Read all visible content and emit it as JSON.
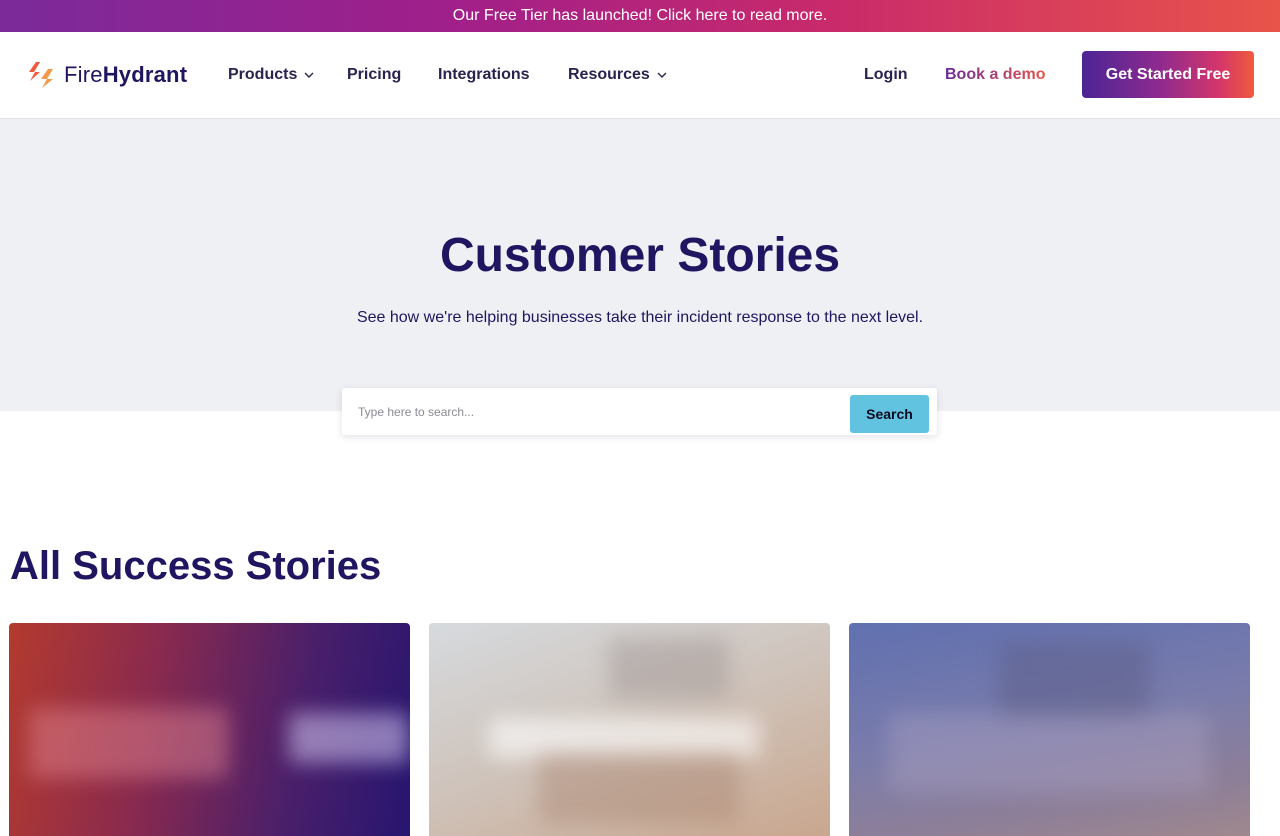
{
  "banner": {
    "text": "Our Free Tier has launched! Click here to read more."
  },
  "logo": {
    "text_light": "Fire",
    "text_bold": "Hydrant",
    "icon": "firehydrant-logo-icon"
  },
  "nav": {
    "items": [
      {
        "label": "Products",
        "has_dropdown": true
      },
      {
        "label": "Pricing",
        "has_dropdown": false
      },
      {
        "label": "Integrations",
        "has_dropdown": false
      },
      {
        "label": "Resources",
        "has_dropdown": true
      }
    ],
    "login": "Login",
    "book_demo": "Book a demo",
    "cta": "Get Started Free"
  },
  "hero": {
    "title": "Customer Stories",
    "subtitle": "See how we're helping businesses take their incident response to the next level."
  },
  "search": {
    "placeholder": "Type here to search...",
    "value": "",
    "button": "Search"
  },
  "section": {
    "title": "All Success Stories"
  },
  "colors": {
    "brand_navy": "#1f1560",
    "hero_bg": "#eff0f4",
    "search_button": "#62c3e0",
    "banner_gradient": [
      "#7b2a9a",
      "#c92a6a",
      "#e8544a"
    ],
    "cta_gradient": [
      "#4b2595",
      "#d4366a",
      "#ef5b3c"
    ],
    "book_demo_gradient": [
      "#6a2a9a",
      "#e8544a"
    ]
  }
}
